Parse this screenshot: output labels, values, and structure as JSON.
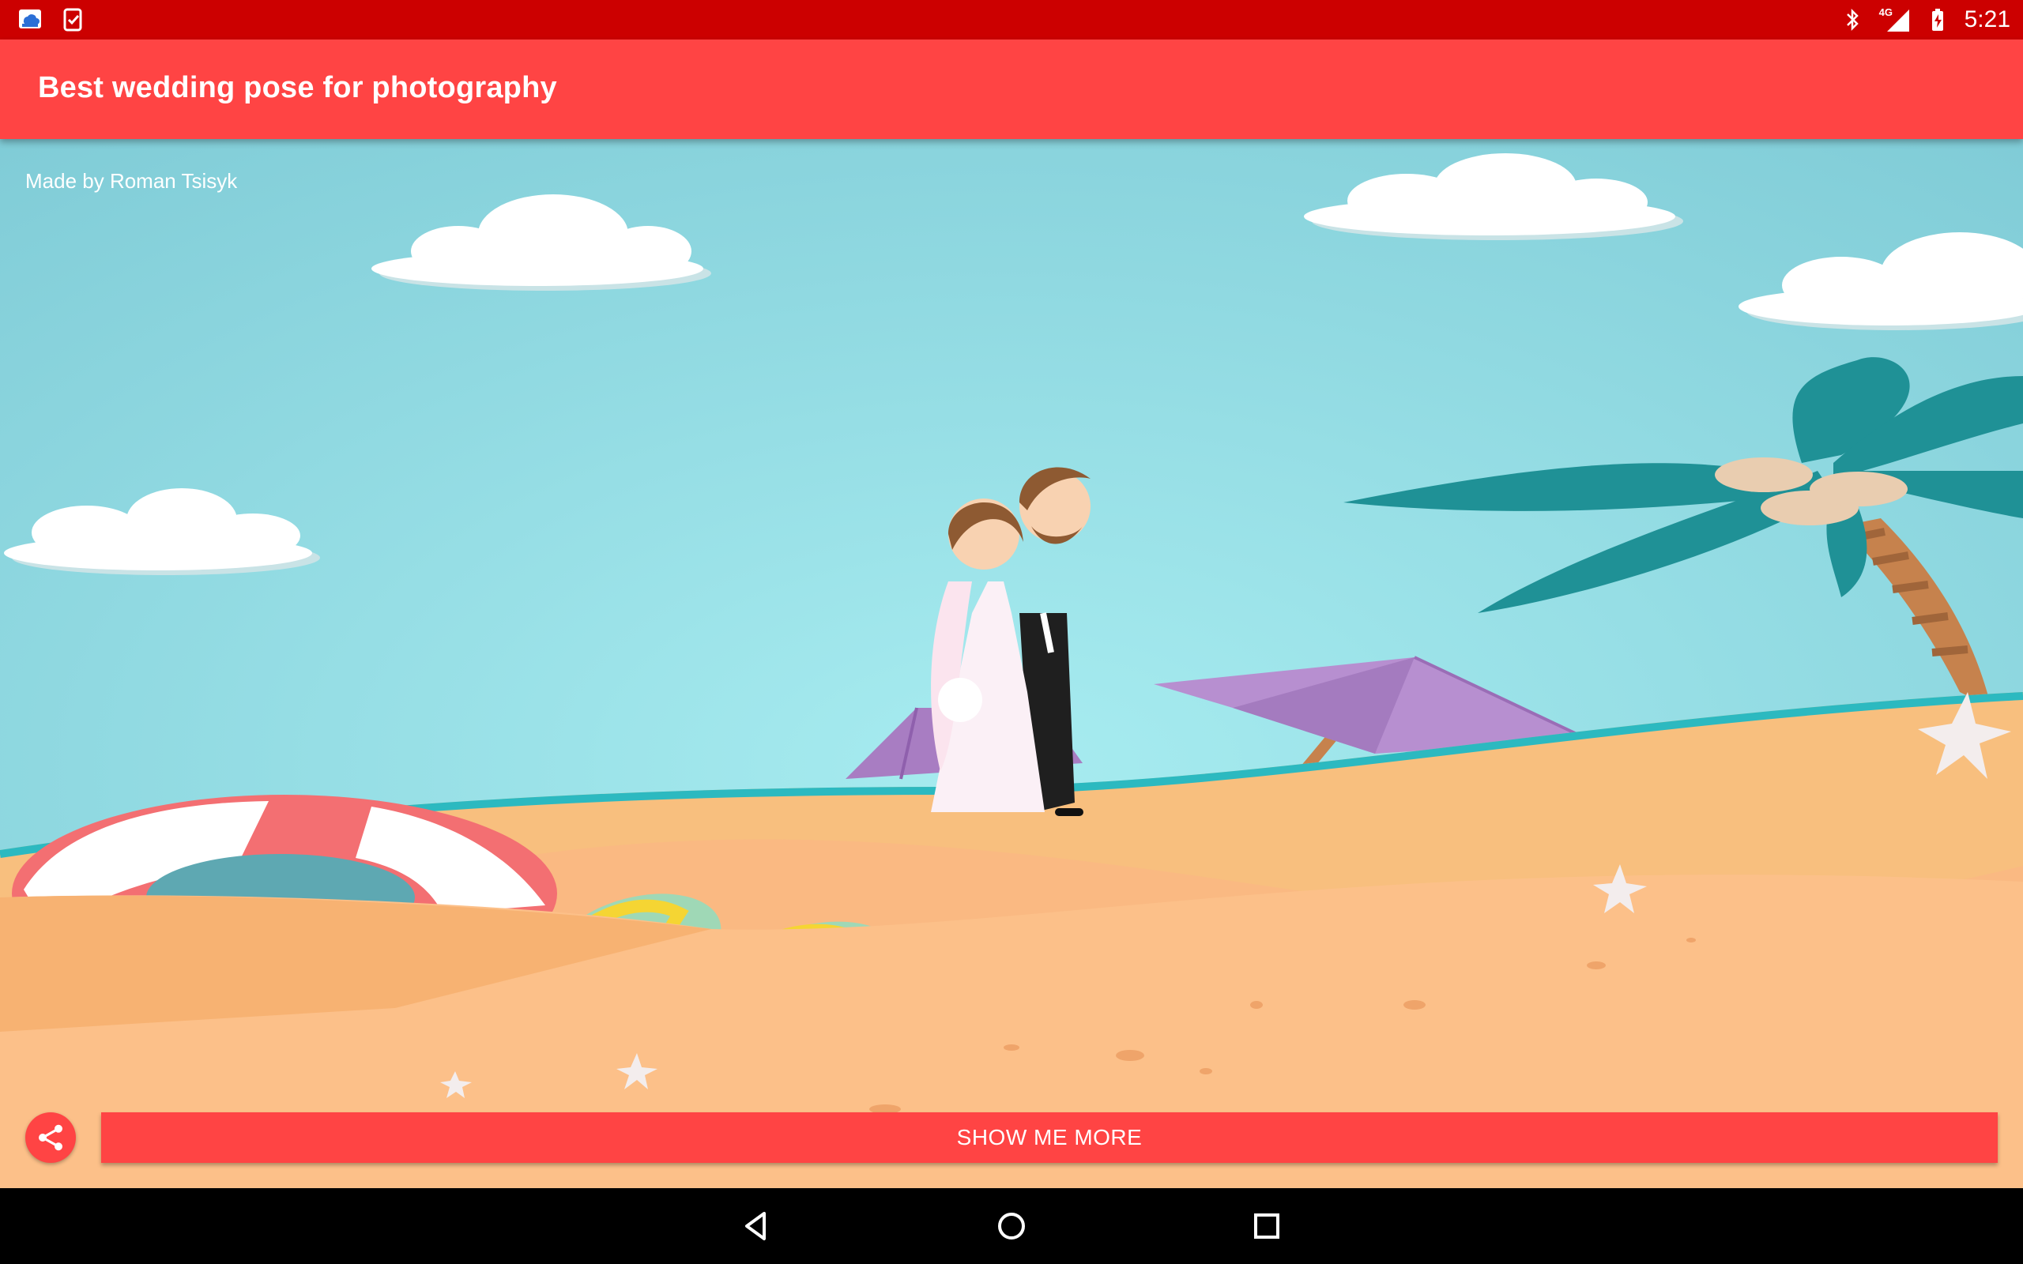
{
  "status_bar": {
    "left_icons": [
      "cloud-app-icon",
      "clipboard-check-icon"
    ],
    "right_icons": [
      "bluetooth-icon",
      "cellular-signal-icon",
      "battery-charging-icon"
    ],
    "network_label": "4G",
    "time": "5:21",
    "background_color": "#cc0000"
  },
  "app_bar": {
    "title": "Best wedding pose for photography",
    "background_color": "#ff4444"
  },
  "content": {
    "credit": "Made by Roman Tsisyk",
    "image_description_icon": "beach-wedding-illustration"
  },
  "actions": {
    "share_icon": "share-icon",
    "more_label": "SHOW ME MORE"
  },
  "nav_bar": {
    "buttons": [
      "back-icon",
      "home-icon",
      "recents-icon"
    ]
  }
}
